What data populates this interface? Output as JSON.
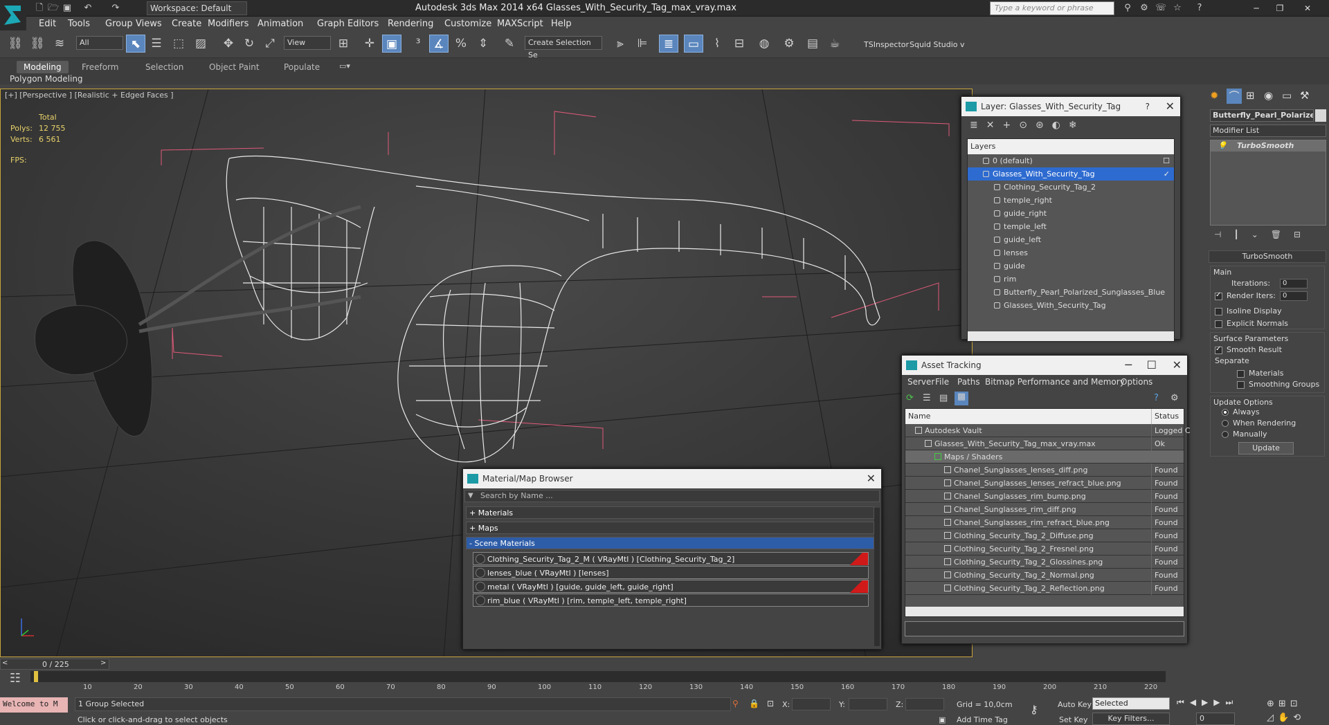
{
  "titlebar": {
    "workspace": "Workspace: Default",
    "title": "Autodesk 3ds Max  2014 x64    Glasses_With_Security_Tag_max_vray.max",
    "search_placeholder": "Type a keyword or phrase"
  },
  "menu": [
    "Edit",
    "Tools",
    "Group",
    "Views",
    "Create",
    "Modifiers",
    "Animation",
    "Graph Editors",
    "Rendering",
    "Customize",
    "MAXScript",
    "Help"
  ],
  "toolbar": {
    "filter": "All",
    "refcoord": "View",
    "selection_set": "Create Selection Se",
    "tsinspector": "TSInspector",
    "squid": "Squid Studio v"
  },
  "ribbon": {
    "tabs": [
      "Modeling",
      "Freeform",
      "Selection",
      "Object Paint",
      "Populate"
    ],
    "active": "Modeling",
    "sub": "Polygon Modeling"
  },
  "viewport": {
    "label": "[+] [Perspective ] [Realistic + Edged Faces ]",
    "total": "Total",
    "polys_label": "Polys:",
    "polys": "12 755",
    "verts_label": "Verts:",
    "verts": "6 561",
    "fps_label": "FPS:"
  },
  "layer_panel": {
    "title": "Layer: Glasses_With_Security_Tag",
    "header": "Layers",
    "items": [
      {
        "label": "0 (default)",
        "indent": 0,
        "selected": false
      },
      {
        "label": "Glasses_With_Security_Tag",
        "indent": 0,
        "selected": true
      },
      {
        "label": "Clothing_Security_Tag_2",
        "indent": 1,
        "selected": false
      },
      {
        "label": "temple_right",
        "indent": 1,
        "selected": false
      },
      {
        "label": "guide_right",
        "indent": 1,
        "selected": false
      },
      {
        "label": "temple_left",
        "indent": 1,
        "selected": false
      },
      {
        "label": "guide_left",
        "indent": 1,
        "selected": false
      },
      {
        "label": "lenses",
        "indent": 1,
        "selected": false
      },
      {
        "label": "guide",
        "indent": 1,
        "selected": false
      },
      {
        "label": "rim",
        "indent": 1,
        "selected": false
      },
      {
        "label": "Butterfly_Pearl_Polarized_Sunglasses_Blue",
        "indent": 1,
        "selected": false
      },
      {
        "label": "Glasses_With_Security_Tag",
        "indent": 1,
        "selected": false
      }
    ]
  },
  "asset_panel": {
    "title": "Asset Tracking",
    "menu": [
      "Server",
      "File",
      "Paths",
      "Bitmap Performance and Memory",
      "Options"
    ],
    "col_name": "Name",
    "col_status": "Status",
    "rows": [
      {
        "name": "Autodesk Vault",
        "status": "Logged C",
        "indent": 1
      },
      {
        "name": "Glasses_With_Security_Tag_max_vray.max",
        "status": "Ok",
        "indent": 2
      },
      {
        "name": "Maps / Shaders",
        "status": "",
        "indent": 3
      },
      {
        "name": "Chanel_Sunglasses_lenses_diff.png",
        "status": "Found",
        "indent": 4
      },
      {
        "name": "Chanel_Sunglasses_lenses_refract_blue.png",
        "status": "Found",
        "indent": 4
      },
      {
        "name": "Chanel_Sunglasses_rim_bump.png",
        "status": "Found",
        "indent": 4
      },
      {
        "name": "Chanel_Sunglasses_rim_diff.png",
        "status": "Found",
        "indent": 4
      },
      {
        "name": "Chanel_Sunglasses_rim_refract_blue.png",
        "status": "Found",
        "indent": 4
      },
      {
        "name": "Clothing_Security_Tag_2_Diffuse.png",
        "status": "Found",
        "indent": 4
      },
      {
        "name": "Clothing_Security_Tag_2_Fresnel.png",
        "status": "Found",
        "indent": 4
      },
      {
        "name": "Clothing_Security_Tag_2_Glossines.png",
        "status": "Found",
        "indent": 4
      },
      {
        "name": "Clothing_Security_Tag_2_Normal.png",
        "status": "Found",
        "indent": 4
      },
      {
        "name": "Clothing_Security_Tag_2_Reflection.png",
        "status": "Found",
        "indent": 4
      }
    ]
  },
  "material_panel": {
    "title": "Material/Map Browser",
    "search_placeholder": "Search by Name ...",
    "groups": [
      "+ Materials",
      "+ Maps",
      "- Scene Materials"
    ],
    "items": [
      {
        "label": "Clothing_Security_Tag_2_M  ( VRayMtl ) [Clothing_Security_Tag_2]",
        "flag": true
      },
      {
        "label": "lenses_blue  ( VRayMtl ) [lenses]",
        "flag": false
      },
      {
        "label": "metal  ( VRayMtl ) [guide, guide_left, guide_right]",
        "flag": true
      },
      {
        "label": "rim_blue  ( VRayMtl ) [rim, temple_left, temple_right]",
        "flag": false
      }
    ]
  },
  "command_panel": {
    "object_name": "Butterfly_Pearl_Polarized",
    "modifier_list": "Modifier List",
    "stack_item": "TurboSmooth",
    "rollout": "TurboSmooth",
    "main": "Main",
    "iterations_label": "Iterations:",
    "iterations": "0",
    "render_iters_label": "Render Iters:",
    "render_iters": "0",
    "isoline": "Isoline Display",
    "explicit": "Explicit Normals",
    "surface": "Surface Parameters",
    "smooth_result": "Smooth Result",
    "separate": "Separate",
    "materials": "Materials",
    "smoothing_groups": "Smoothing Groups",
    "update_options": "Update Options",
    "always": "Always",
    "when_rendering": "When Rendering",
    "manually": "Manually",
    "update_btn": "Update"
  },
  "timeline": {
    "frame": "0 / 225",
    "ticks": [
      "10",
      "20",
      "30",
      "40",
      "50",
      "60",
      "70",
      "80",
      "90",
      "100",
      "110",
      "120",
      "130",
      "140",
      "150",
      "160",
      "170",
      "180",
      "190",
      "200",
      "210",
      "220"
    ]
  },
  "status": {
    "welcome": "Welcome to M",
    "selected": "1 Group Selected",
    "prompt": "Click or click-and-drag to select objects",
    "x_label": "X:",
    "y_label": "Y:",
    "z_label": "Z:",
    "grid": "Grid = 10,0cm",
    "add_time_tag": "Add Time Tag",
    "auto_key": "Auto Key",
    "set_key": "Set Key",
    "selected_dd": "Selected",
    "key_filters": "Key Filters...",
    "frame_field": "0"
  }
}
